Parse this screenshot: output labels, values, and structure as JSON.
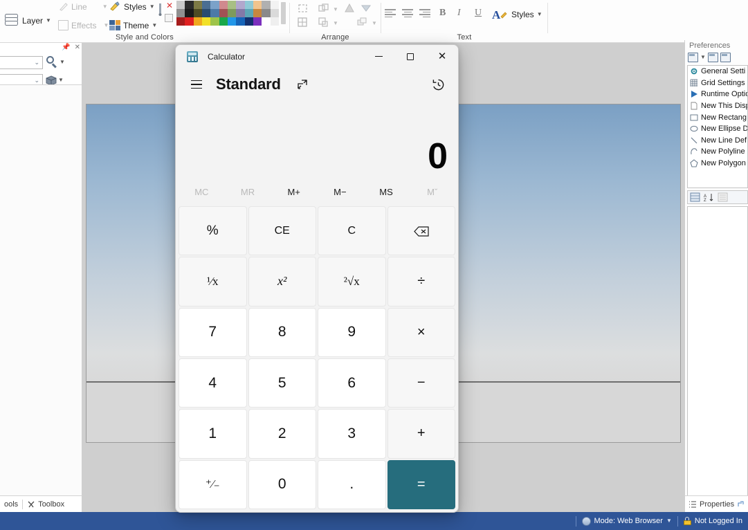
{
  "background_app": {
    "ribbon": {
      "groups": [
        {
          "title": "Style and Colors",
          "items": [
            {
              "label": "Layer",
              "icon": "layers-icon",
              "has_caret": true,
              "disabled": false
            },
            {
              "label": "Line",
              "icon": "line-pen-icon",
              "has_caret": true,
              "disabled": true
            },
            {
              "label": "Effects",
              "icon": "effects-square-icon",
              "has_caret": true,
              "disabled": true
            },
            {
              "label": "Styles",
              "icon": "styles-brush-icon",
              "has_caret": true,
              "disabled": false
            },
            {
              "label": "Theme",
              "icon": "theme-swatch-icon",
              "has_caret": true,
              "disabled": false
            }
          ],
          "palette_colors_row1": [
            "#c9c9c9",
            "#2b2b2b",
            "#7d7a45",
            "#4a6e92",
            "#7ba2c9",
            "#d08a8e",
            "#a8bf84",
            "#b1a7cd",
            "#8fc9d6",
            "#f0c48e",
            "#b0b0b0",
            "#f2f2f2"
          ],
          "palette_colors_row2": [
            "#8f8f8f",
            "#1a1a1a",
            "#4e4c24",
            "#2a4c70",
            "#4c7aa8",
            "#a05254",
            "#7e9a5c",
            "#8379a8",
            "#5da6b6",
            "#c7873f",
            "#8a8a8a",
            "#dadada"
          ],
          "palette_colors_row3": [
            "#a61c1c",
            "#e02020",
            "#f0a81e",
            "#f2e028",
            "#9ec44a",
            "#18a84a",
            "#2196e8",
            "#1664b8",
            "#13306e",
            "#7b2fbd",
            "#ffffff",
            "#efefef"
          ]
        },
        {
          "title": "Arrange",
          "items": []
        },
        {
          "title": "Text",
          "items": [
            {
              "label": "Styles",
              "icon": "text-styles-icon",
              "has_caret": true,
              "disabled": false
            }
          ],
          "glyphs": [
            "B",
            "I",
            "U"
          ]
        }
      ]
    },
    "left_dock": {
      "pin_icon": "pin-icon",
      "close_icon": "close-icon",
      "combo_top_value": "",
      "combo_bottom_value": "",
      "search_icon": "magnifier-icon",
      "cube_icon": "cube-icon",
      "tabs": [
        "ools",
        "Toolbox"
      ],
      "toolbox_icon": "tools-icon"
    },
    "preferences": {
      "title": "Preferences",
      "toolbar_icons": [
        "new-preference-icon",
        "open-preference-icon",
        "save-preference-icon"
      ],
      "items": [
        {
          "label": "General Setti",
          "icon": "gear-icon"
        },
        {
          "label": "Grid Settings",
          "icon": "grid-icon"
        },
        {
          "label": "Runtime Optio",
          "icon": "play-icon"
        },
        {
          "label": "New This Disp",
          "icon": "page-icon"
        },
        {
          "label": "New Rectang",
          "icon": "rectangle-icon"
        },
        {
          "label": "New Ellipse D",
          "icon": "ellipse-icon"
        },
        {
          "label": "New Line Def",
          "icon": "line-icon"
        },
        {
          "label": "New Polyline",
          "icon": "polyline-icon"
        },
        {
          "label": "New Polygon",
          "icon": "polygon-icon"
        }
      ],
      "sort_icons": [
        "category-view-icon",
        "alphabetical-sort-icon",
        "list-view-icon"
      ],
      "properties_tab": "Properties",
      "properties_icon": "properties-list-icon"
    },
    "status_bar": {
      "mode_label": "Mode: Web Browser",
      "mode_icon": "globe-icon",
      "login_label": "Not Logged In",
      "login_icon": "lock-icon",
      "accent": "#2f5597"
    }
  },
  "calculator": {
    "titlebar": {
      "app_icon": "calculator-icon",
      "title": "Calculator",
      "minimize_label": "–",
      "maximize_label": "□",
      "close_label": "✕"
    },
    "header": {
      "menu_icon": "hamburger-menu-icon",
      "mode": "Standard",
      "keep_on_top_icon": "keep-on-top-icon",
      "history_icon": "history-clock-icon"
    },
    "display": {
      "value": "0"
    },
    "memory_buttons": [
      {
        "label": "MC",
        "enabled": false
      },
      {
        "label": "MR",
        "enabled": false
      },
      {
        "label": "M+",
        "enabled": true
      },
      {
        "label": "M−",
        "enabled": true
      },
      {
        "label": "MS",
        "enabled": true
      },
      {
        "label": "Mˇ",
        "enabled": false
      }
    ],
    "keypad": [
      {
        "label": "%",
        "kind": "fn",
        "name": "percent-button"
      },
      {
        "label": "CE",
        "kind": "fn",
        "name": "clear-entry-button"
      },
      {
        "label": "C",
        "kind": "fn",
        "name": "clear-button"
      },
      {
        "label": "",
        "kind": "fn",
        "name": "backspace-button",
        "icon": "backspace-icon"
      },
      {
        "label": "¹⁄x",
        "kind": "fn",
        "name": "reciprocal-button"
      },
      {
        "label": "x²",
        "kind": "fn",
        "name": "square-button"
      },
      {
        "label": "²√x",
        "kind": "fn",
        "name": "square-root-button"
      },
      {
        "label": "÷",
        "kind": "op",
        "name": "divide-button"
      },
      {
        "label": "7",
        "kind": "num",
        "name": "seven-button"
      },
      {
        "label": "8",
        "kind": "num",
        "name": "eight-button"
      },
      {
        "label": "9",
        "kind": "num",
        "name": "nine-button"
      },
      {
        "label": "×",
        "kind": "op",
        "name": "multiply-button"
      },
      {
        "label": "4",
        "kind": "num",
        "name": "four-button"
      },
      {
        "label": "5",
        "kind": "num",
        "name": "five-button"
      },
      {
        "label": "6",
        "kind": "num",
        "name": "six-button"
      },
      {
        "label": "−",
        "kind": "op",
        "name": "subtract-button"
      },
      {
        "label": "1",
        "kind": "num",
        "name": "one-button"
      },
      {
        "label": "2",
        "kind": "num",
        "name": "two-button"
      },
      {
        "label": "3",
        "kind": "num",
        "name": "three-button"
      },
      {
        "label": "+",
        "kind": "op",
        "name": "add-button"
      },
      {
        "label": "⁺⁄₋",
        "kind": "num",
        "name": "negate-button"
      },
      {
        "label": "0",
        "kind": "num",
        "name": "zero-button"
      },
      {
        "label": ".",
        "kind": "num",
        "name": "decimal-button"
      },
      {
        "label": "=",
        "kind": "eq",
        "name": "equals-button"
      }
    ],
    "accent_color": "#266d7d"
  }
}
